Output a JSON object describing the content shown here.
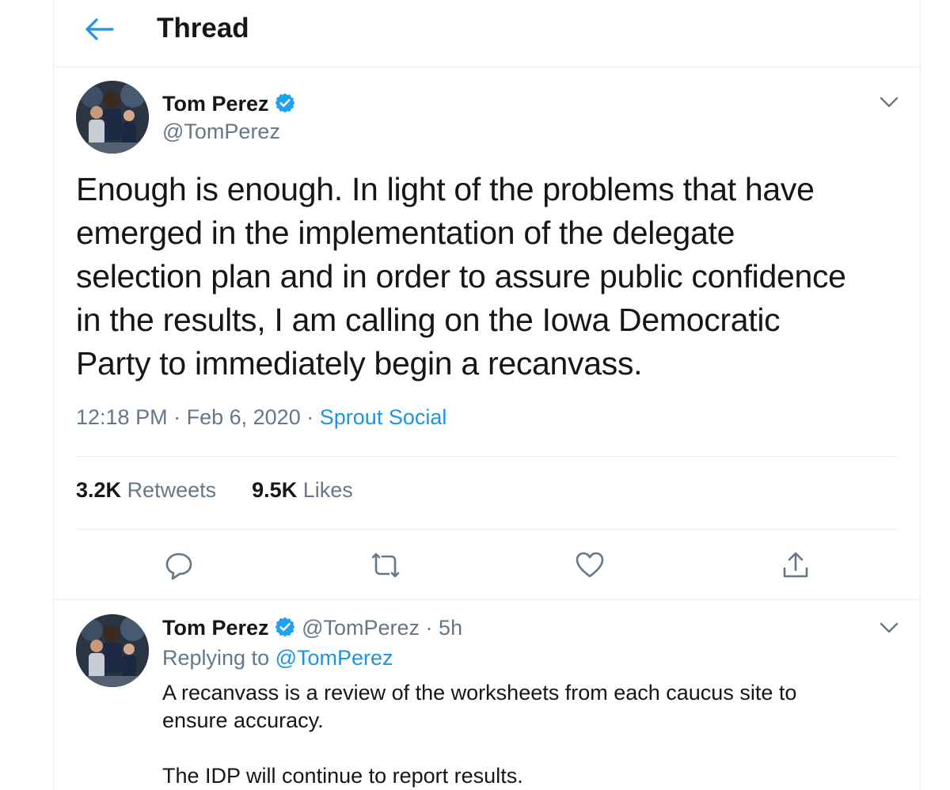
{
  "header": {
    "title": "Thread",
    "back_icon": "back-arrow-icon"
  },
  "main_tweet": {
    "author": {
      "name": "Tom Perez",
      "handle": "@TomPerez",
      "verified": true
    },
    "text": "Enough is enough. In light of the problems that have\nemerged in the implementation of the delegate\nselection plan and in order to assure public confidence\nin the results, I am calling on the Iowa Democratic\nParty to immediately begin a recanvass.",
    "time": "12:18 PM",
    "date": "Feb 6, 2020",
    "separator": "·",
    "source": "Sprout Social",
    "stats": {
      "retweets_count": "3.2K",
      "retweets_label": "Retweets",
      "likes_count": "9.5K",
      "likes_label": "Likes"
    },
    "actions": [
      "reply-icon",
      "retweet-icon",
      "like-icon",
      "share-icon"
    ]
  },
  "reply_tweet": {
    "author": {
      "name": "Tom Perez",
      "handle": "@TomPerez",
      "verified": true
    },
    "time_sep": "·",
    "time": "5h",
    "replying_prefix": "Replying to",
    "replying_to": "@TomPerez",
    "text": "A recanvass is a review of the worksheets from each caucus site to\nensure accuracy.\n\nThe IDP will continue to report results."
  },
  "colors": {
    "accent": "#1b95e0",
    "secondary_text": "#657786",
    "border": "#e6ecf0",
    "verified": "#1da1f2"
  }
}
